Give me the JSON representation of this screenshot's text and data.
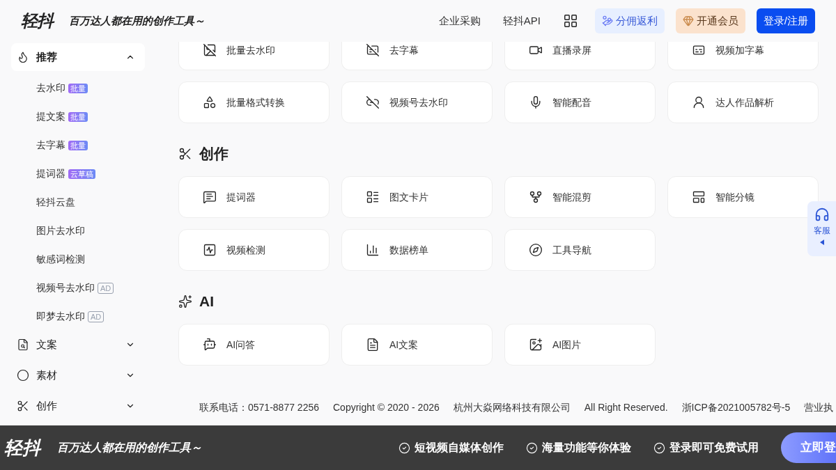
{
  "header": {
    "logo": "轻抖",
    "slogan": "百万达人都在用的创作工具～",
    "links": [
      "企业采购",
      "轻抖API"
    ],
    "commission_button": "分佣返利",
    "vip_button": "开通会员",
    "login_button": "登录/注册"
  },
  "sidebar": {
    "items": [
      {
        "label": "推荐",
        "expanded": true,
        "selected": true,
        "children": [
          {
            "label": "去水印",
            "badge": {
              "text": "批量",
              "kind": "filled"
            }
          },
          {
            "label": "提文案",
            "badge": {
              "text": "批量",
              "kind": "filled"
            }
          },
          {
            "label": "去字幕",
            "badge": {
              "text": "批量",
              "kind": "filled"
            }
          },
          {
            "label": "提词器",
            "badge": {
              "text": "云草稿",
              "kind": "filled"
            }
          },
          {
            "label": "轻抖云盘"
          },
          {
            "label": "图片去水印"
          },
          {
            "label": "敏感词检测"
          },
          {
            "label": "视频号去水印",
            "badge": {
              "text": "AD",
              "kind": "outline"
            }
          },
          {
            "label": "即梦去水印",
            "badge": {
              "text": "AD",
              "kind": "outline"
            }
          }
        ]
      },
      {
        "label": "文案",
        "expanded": false,
        "selected": false
      },
      {
        "label": "素材",
        "expanded": false,
        "selected": false
      },
      {
        "label": "创作",
        "expanded": false,
        "selected": false
      }
    ]
  },
  "sections": [
    {
      "tools": [
        "批量去水印",
        "去字幕",
        "直播录屏",
        "视频加字幕",
        "批量格式转换",
        "视频号去水印",
        "智能配音",
        "达人作品解析"
      ]
    },
    {
      "title": "创作",
      "tools": [
        "提词器",
        "图文卡片",
        "智能混剪",
        "智能分镜",
        "视频检测",
        "数据榜单",
        "工具导航"
      ]
    },
    {
      "title": "AI",
      "tools": [
        "AI问答",
        "AI文案",
        "AI图片"
      ]
    }
  ],
  "footer": [
    "联系电话：0571-8877 2256",
    "Copyright © 2020 - 2026",
    "杭州大焱网络科技有限公司",
    "All Right Reserved.",
    "浙ICP备2021005782号-5",
    "营业执"
  ],
  "support_tab": {
    "label": "客服"
  },
  "banner": {
    "logo": "轻抖",
    "slogan": "百万达人都在用的创作工具～",
    "features": [
      "短视频自媒体创作",
      "海量功能等你体验",
      "登录即可免费试用"
    ],
    "cta": "立即登"
  }
}
